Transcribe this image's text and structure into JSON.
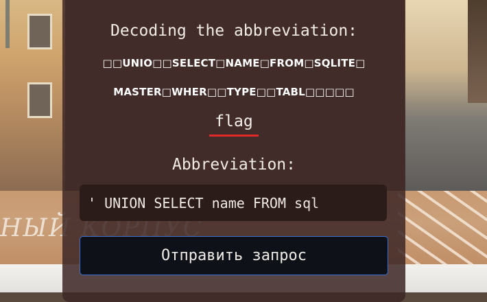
{
  "background": {
    "corpus_text": "НЫЙ КОРПУС"
  },
  "panel": {
    "cut_top_text": ",",
    "decode_label": "Decoding the abbreviation:",
    "decoded_line1": "□□UNIO□□SELECT□NAME□FROM□SQLITE□",
    "decoded_line2": "MASTER□WHER□□TYPE□□TABL□□□□□",
    "flag_text": "flag",
    "abbrev_label": "Abbreviation:",
    "abbrev_input_value": "' UNION SELECT name FROM sql",
    "submit_label": "Отправить запрос"
  },
  "colors": {
    "panel_bg": "#3e2826",
    "input_bg": "#2b1b19",
    "button_bg": "#0e1218",
    "button_border": "#3a6fd4",
    "flag_underline": "#e02a2a"
  }
}
